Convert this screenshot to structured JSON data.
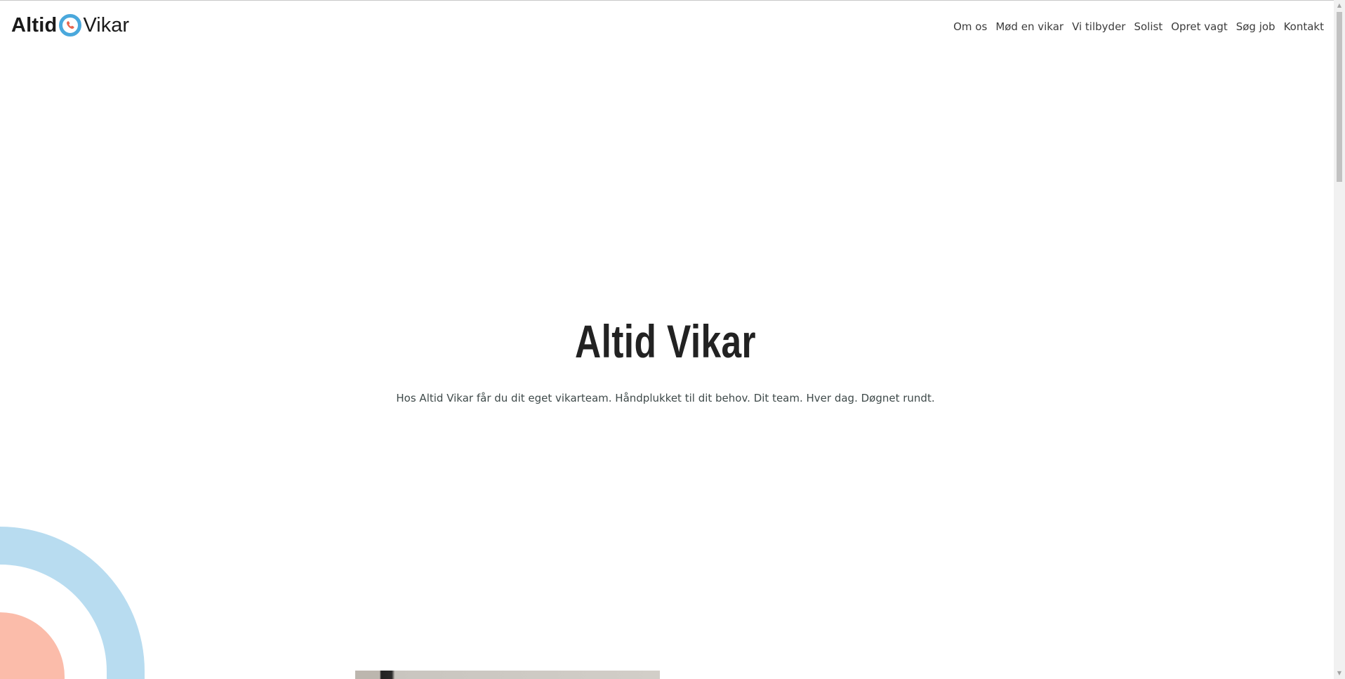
{
  "header": {
    "logo": {
      "bold": "Altid",
      "light": "Vikar",
      "icon": "phone-in-circle-icon"
    },
    "nav": [
      {
        "label": "Om os"
      },
      {
        "label": "Mød en vikar"
      },
      {
        "label": "Vi tilbyder"
      },
      {
        "label": "Solist"
      },
      {
        "label": "Opret vagt"
      },
      {
        "label": "Søg job"
      },
      {
        "label": "Kontakt"
      }
    ]
  },
  "hero": {
    "title": "Altid Vikar",
    "subtitle": "Hos Altid Vikar får du dit eget vikarteam. Håndplukket til dit behov. Dit team. Hver dag. Døgnet rundt."
  },
  "colors": {
    "brand_blue": "#4aa8dc",
    "logo_phone": "#e8654e",
    "deco_blue": "#b8dcf0",
    "deco_peach": "#fbbcaa"
  }
}
